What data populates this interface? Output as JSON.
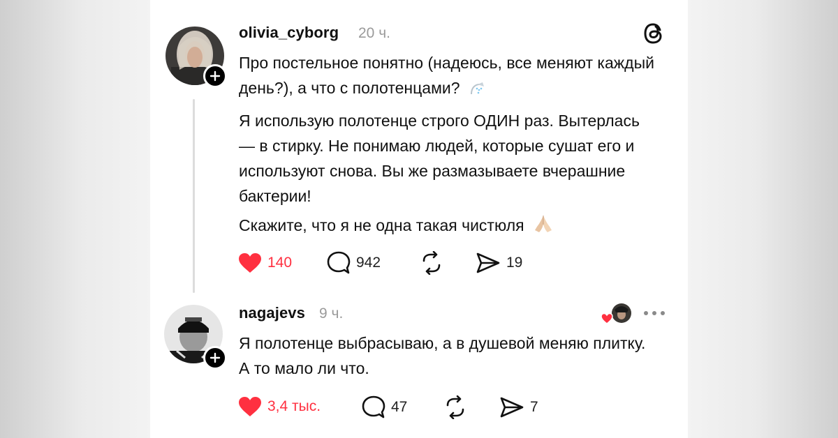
{
  "posts": [
    {
      "username": "olivia_cyborg",
      "time": "20 ч.",
      "paragraphs": [
        "Про постельное понятно (надеюсь, все меняют каждый день?), а что с полотенцами?",
        "Я использую полотенце строго ОДИН раз. Вытерлась — в стирку. Не понимаю людей, которые сушат его и используют снова. Вы же размазываете вчерашние бактерии!",
        "Скажите, что я не одна такая чистюля"
      ],
      "actions": {
        "likes": "140",
        "comments": "942",
        "reposts": "",
        "shares": "19"
      },
      "emoji": [
        "shower-icon",
        "praying-hands-icon"
      ]
    },
    {
      "username": "nagajevs",
      "time": "9 ч.",
      "paragraphs": [
        "Я полотенце выбрасываю, а в душевой меняю плитку. А то мало ли что."
      ],
      "actions": {
        "likes": "3,4 тыс.",
        "comments": "47",
        "reposts": "",
        "shares": "7"
      }
    }
  ],
  "colors": {
    "like": "#ff3040",
    "muted": "#9a9a9a",
    "thread_line": "#dcdcdc"
  },
  "icons": {
    "app_logo": "threads-logo-icon",
    "like": "heart-filled-icon",
    "comment": "speech-bubble-icon",
    "repost": "repost-arrows-icon",
    "share": "paper-plane-icon",
    "more": "more-dots-icon",
    "liked_by_author": "heart-avatar-icon",
    "follow": "plus-icon"
  }
}
